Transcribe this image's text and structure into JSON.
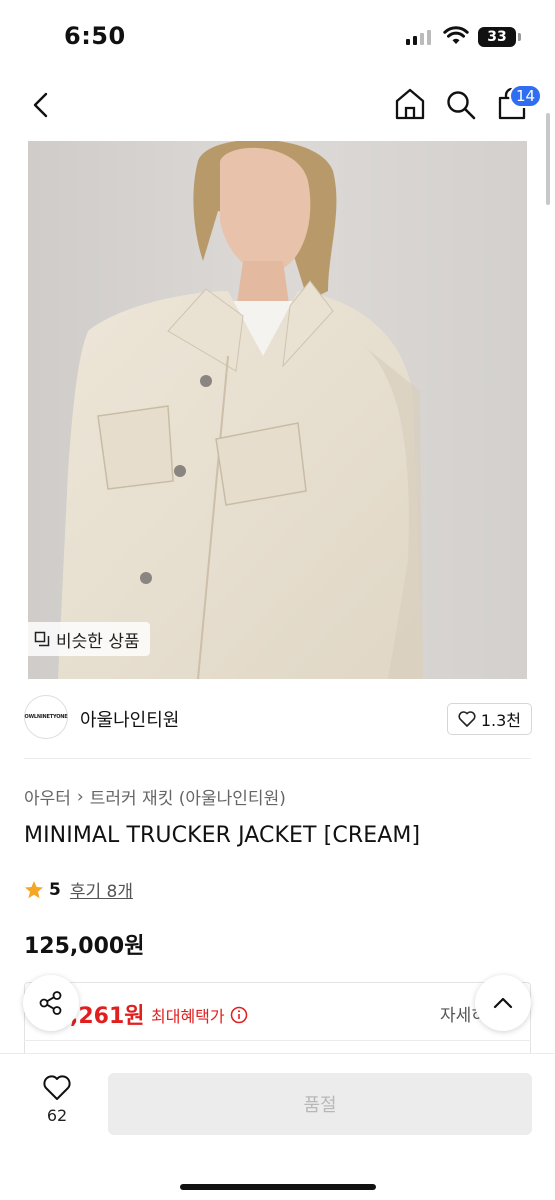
{
  "status_bar": {
    "time": "6:50",
    "battery": "33"
  },
  "nav": {
    "cart_count": "14"
  },
  "image": {
    "similar_label": "비슷한 상품"
  },
  "brand": {
    "logo_text": "OWLNINETYONE",
    "name": "아울나인티원",
    "likes": "1.3천"
  },
  "product": {
    "breadcrumb": [
      "아우터",
      "트러커 재킷 (아울나인티원)"
    ],
    "title": "MINIMAL TRUCKER JACKET [CREAM]",
    "rating": "5",
    "reviews": "후기 8개",
    "price": "125,000원"
  },
  "benefit": {
    "price": ",261원",
    "label": "최대혜택가",
    "detail": "자세히"
  },
  "bottom": {
    "wish_count": "62",
    "buy_label": "품절"
  },
  "colors": {
    "accent_blue": "#2f6ef2",
    "sale_red": "#e21f1f",
    "star": "#f5a623"
  }
}
